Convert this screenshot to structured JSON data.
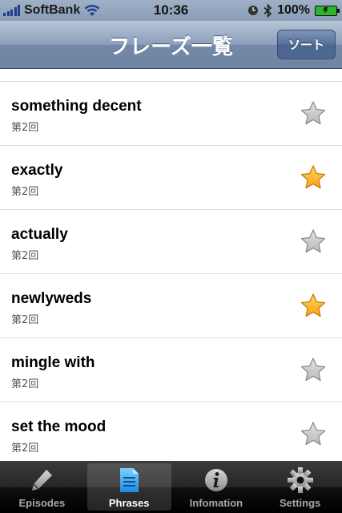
{
  "status_bar": {
    "carrier": "SoftBank",
    "time": "10:36",
    "battery": "100%",
    "icons": [
      "signal-icon",
      "wifi-icon",
      "clock-icon",
      "bluetooth-icon",
      "battery-charging-icon"
    ]
  },
  "nav": {
    "title": "フレーズ一覧",
    "sort_label": "ソート"
  },
  "phrases": [
    {
      "title": "something decent",
      "episode": "第2回",
      "starred": false
    },
    {
      "title": "exactly",
      "episode": "第2回",
      "starred": true
    },
    {
      "title": "actually",
      "episode": "第2回",
      "starred": false
    },
    {
      "title": "newlyweds",
      "episode": "第2回",
      "starred": true
    },
    {
      "title": "mingle with",
      "episode": "第2回",
      "starred": false
    },
    {
      "title": "set the mood",
      "episode": "第2回",
      "starred": false
    }
  ],
  "tabs": [
    {
      "label": "Episodes",
      "icon": "pencil-icon",
      "active": false
    },
    {
      "label": "Phrases",
      "icon": "document-icon",
      "active": true
    },
    {
      "label": "Infomation",
      "icon": "info-icon",
      "active": false
    },
    {
      "label": "Settings",
      "icon": "gear-icon",
      "active": false
    }
  ],
  "colors": {
    "star_on": "#f5a21b",
    "star_off": "#b9b9b9",
    "nav_accent": "#6f84a3"
  }
}
